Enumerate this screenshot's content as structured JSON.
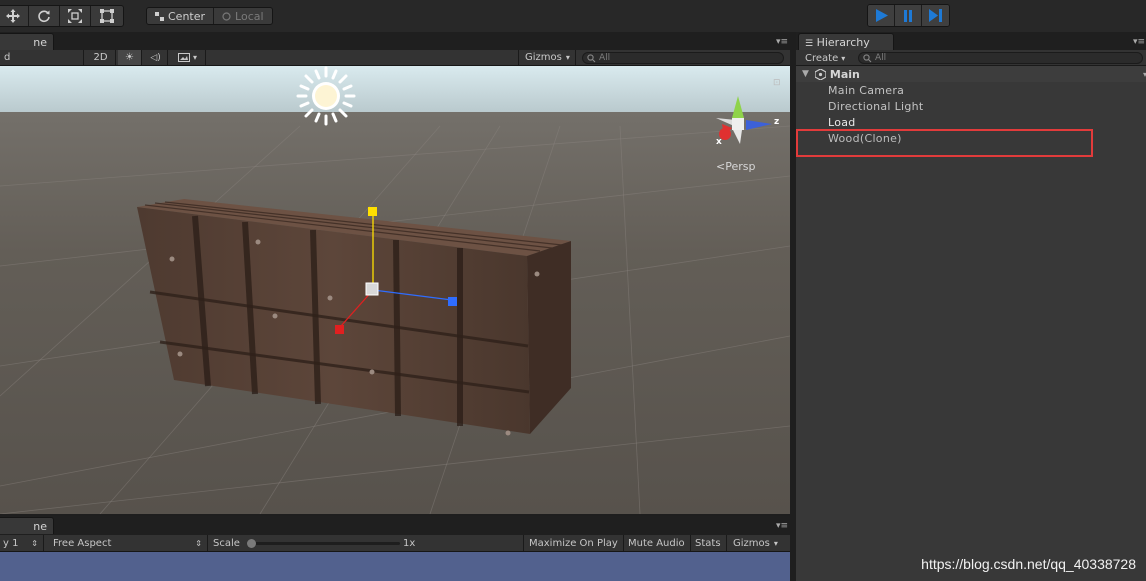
{
  "colors": {
    "play_active": "#1e7ad6",
    "highlight_box": "#e23b3b",
    "scene_ground": "#5f5a54",
    "sky": "#cfe2e8",
    "game_view_bg": "#52618e"
  },
  "toolbar": {
    "transform_tools": [
      "move-tool-icon",
      "rotate-tool-icon",
      "scale-tool-icon",
      "rect-tool-icon"
    ],
    "pivot_center_label": "Center",
    "pivot_local_label": "Local",
    "play_icons": [
      "play-icon",
      "pause-icon",
      "step-icon"
    ]
  },
  "scene": {
    "tab_label": "ne",
    "shading_label": "d",
    "mode_2d_label": "2D",
    "gizmos_label": "Gizmos",
    "search_placeholder": "All",
    "persp_label": "Persp",
    "axis_x_label": "x",
    "axis_z_label": "z"
  },
  "game": {
    "tab_label": "ne",
    "display_label": "y 1",
    "aspect_label": "Free Aspect",
    "scale_label": "Scale",
    "scale_value": "1x",
    "scale_level": 0,
    "maximize_label": "Maximize On Play",
    "mute_label": "Mute Audio",
    "stats_label": "Stats",
    "gizmos_label": "Gizmos"
  },
  "hierarchy": {
    "tab_label": "Hierarchy",
    "create_label": "Create",
    "search_placeholder": "All",
    "scene_name": "Main",
    "items": [
      "Main Camera",
      "Directional Light",
      "Load",
      "Wood(Clone)"
    ]
  },
  "watermark": "https://blog.csdn.net/qq_40338728"
}
